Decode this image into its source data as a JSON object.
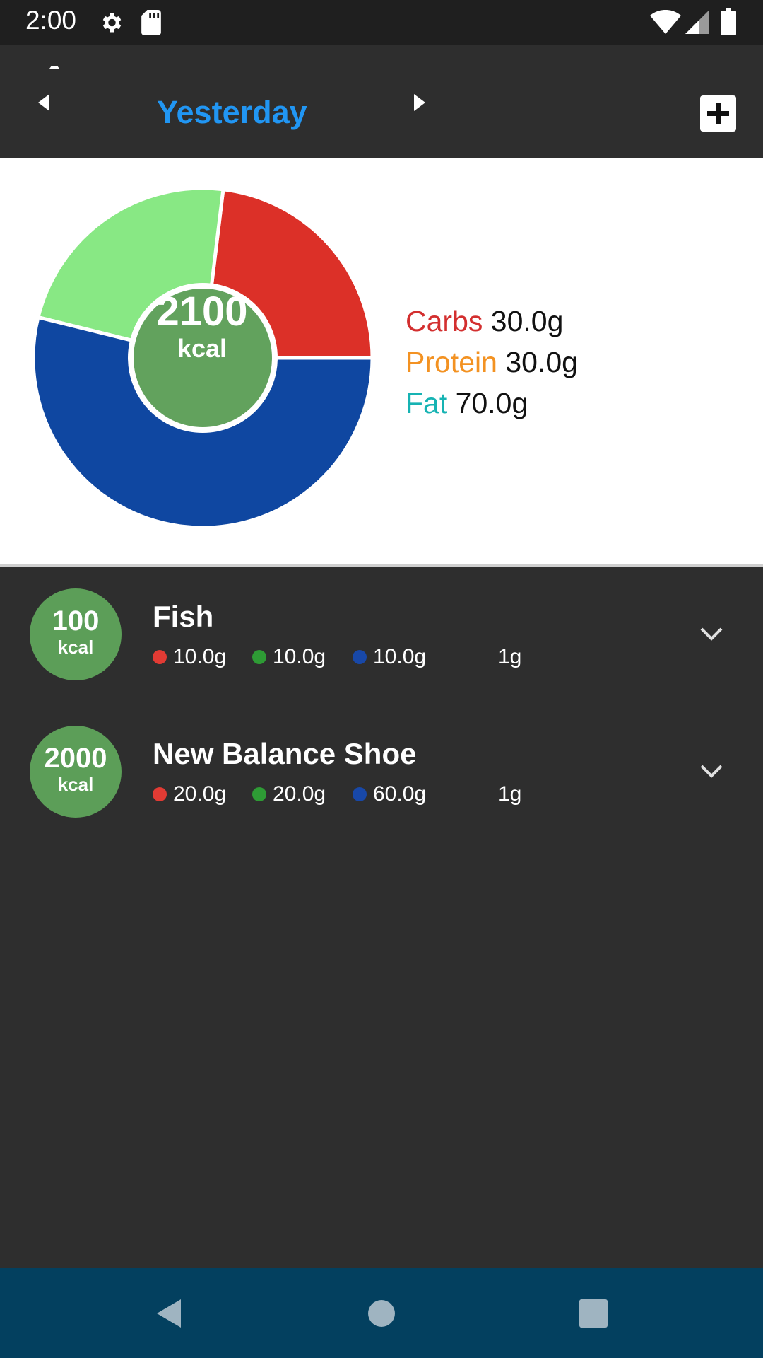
{
  "status_bar": {
    "time": "2:00",
    "icons": [
      "gear-icon",
      "sd-card-icon",
      "wifi-icon",
      "signal-icon",
      "battery-icon"
    ]
  },
  "header": {
    "title": "Yesterday",
    "prev_icon": "caret-left-icon",
    "next_icon": "caret-right-icon",
    "add_icon": "plus-icon"
  },
  "summary": {
    "total_kcal": "2100",
    "kcal_unit": "kcal",
    "legend": [
      {
        "label": "Carbs",
        "value": "30.0g",
        "color": "#d32f2f"
      },
      {
        "label": "Protein",
        "value": "30.0g",
        "color": "#f39222"
      },
      {
        "label": "Fat",
        "value": "70.0g",
        "color": "#16b3b3"
      }
    ],
    "chart_data": {
      "type": "pie",
      "categories": [
        "Carbs",
        "Protein",
        "Fat"
      ],
      "values": [
        30.0,
        30.0,
        70.0
      ],
      "slice_colors": [
        "#dc3028",
        "#88e884",
        "#0f47a1"
      ],
      "center_color": "#62a25d"
    }
  },
  "foods": [
    {
      "kcal": "100",
      "kcal_unit": "kcal",
      "name": "Fish",
      "macros": [
        {
          "value": "10.0g",
          "color": "#e23b34"
        },
        {
          "value": "10.0g",
          "color": "#2e9b35"
        },
        {
          "value": "10.0g",
          "color": "#1848a8"
        }
      ],
      "serving": "1g"
    },
    {
      "kcal": "2000",
      "kcal_unit": "kcal",
      "name": "New Balance Shoe",
      "macros": [
        {
          "value": "20.0g",
          "color": "#e23b34"
        },
        {
          "value": "20.0g",
          "color": "#2e9b35"
        },
        {
          "value": "60.0g",
          "color": "#1848a8"
        }
      ],
      "serving": "1g"
    }
  ],
  "nav_bar": {
    "buttons": [
      "back-icon",
      "home-icon",
      "recents-icon"
    ]
  }
}
